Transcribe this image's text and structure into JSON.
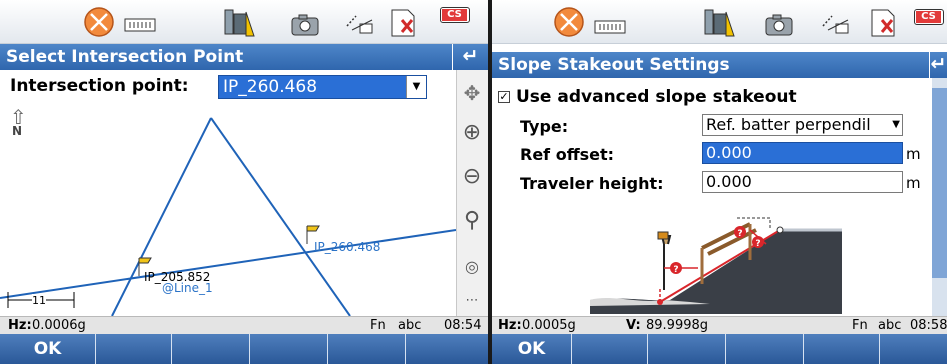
{
  "left_screen": {
    "icons": [
      "prism-icon",
      "battery-icon",
      "instrument-icon",
      "camera-icon",
      "measure-icon",
      "sd-card-icon",
      "cs-badge-icon"
    ],
    "cs_badge": "CS",
    "title": "Select Intersection Point",
    "intersection_label": "Intersection point:",
    "intersection_value": "IP_260.468",
    "north_label": "N",
    "map_labels": {
      "point_1": "IP_260.468",
      "point_2": "IP_205.852",
      "point_2_line": "@Line_1",
      "scale": "11"
    },
    "status": {
      "hz_label": "Hz:",
      "hz_value": "0.0006g",
      "fn": "Fn",
      "mode": "abc",
      "time": "08:54"
    },
    "softkeys": [
      "OK",
      "",
      "",
      "",
      "",
      ""
    ]
  },
  "right_screen": {
    "icons": [
      "prism-icon",
      "battery-icon",
      "instrument-icon",
      "camera-icon",
      "measure-icon",
      "sd-card-icon",
      "cs-badge-icon"
    ],
    "cs_badge": "CS",
    "title": "Slope Stakeout Settings",
    "checkbox_label": "Use advanced slope stakeout",
    "checkbox_checked": true,
    "type_label": "Type:",
    "type_value": "Ref. batter perpendil",
    "ref_offset_label": "Ref offset:",
    "ref_offset_value": "0.000",
    "traveler_label": "Traveler height:",
    "traveler_value": "0.000",
    "unit": "m",
    "status": {
      "hz_label": "Hz:",
      "hz_value": "0.0005g",
      "v_label": "V:",
      "v_value": "89.9998g",
      "fn": "Fn",
      "mode": "abc",
      "time": "08:58"
    },
    "softkeys": [
      "OK",
      "",
      "",
      "",
      "",
      ""
    ]
  },
  "colors": {
    "title_blue": "#2f66ad",
    "selection_blue": "#2a6fd6",
    "map_line": "#1f63b8",
    "status_gray": "#e4e4e4",
    "slope_red": "#d9262b"
  }
}
